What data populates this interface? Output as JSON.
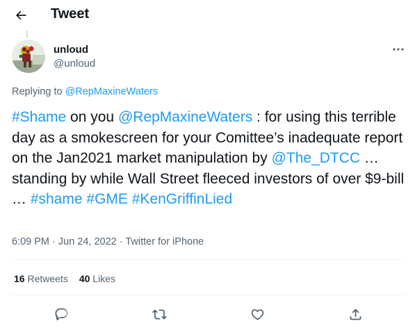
{
  "header": {
    "title": "Tweet"
  },
  "author": {
    "display_name": "unloud",
    "handle": "@unloud"
  },
  "replying": {
    "prefix": "Replying to ",
    "mention": "@RepMaxineWaters"
  },
  "tweet": {
    "hashtag_shame": "#Shame",
    "t1": " on you ",
    "mention_maxine": "@RepMaxineWaters",
    "t2": " : for using this terrible day as a smokescreen for your Comittee’s inadequate report on the Jan2021 market manipulation by ",
    "mention_dtcc": "@The_DTCC",
    "t3": " … standing by while Wall Street fleeced investors of over $9-bill … ",
    "hashtag_shame2": "#shame",
    "hashtag_gme": "#GME",
    "hashtag_kgl": "#KenGriffinLied"
  },
  "meta": {
    "time": "6:09 PM",
    "sep1": " · ",
    "date": "Jun 24, 2022",
    "sep2": " · ",
    "source": "Twitter for iPhone"
  },
  "stats": {
    "retweets_count": "16",
    "retweets_label": " Retweets",
    "likes_count": "40",
    "likes_label": " Likes"
  },
  "icons": {
    "back": "arrow-left-icon",
    "more": "more-horizontal-icon",
    "reply": "reply-icon",
    "retweet": "retweet-icon",
    "like": "heart-icon",
    "share": "share-icon"
  },
  "colors": {
    "accent": "#1d9bf0",
    "text": "#0f1419",
    "secondary": "#536471",
    "divider": "#eff3f4"
  }
}
